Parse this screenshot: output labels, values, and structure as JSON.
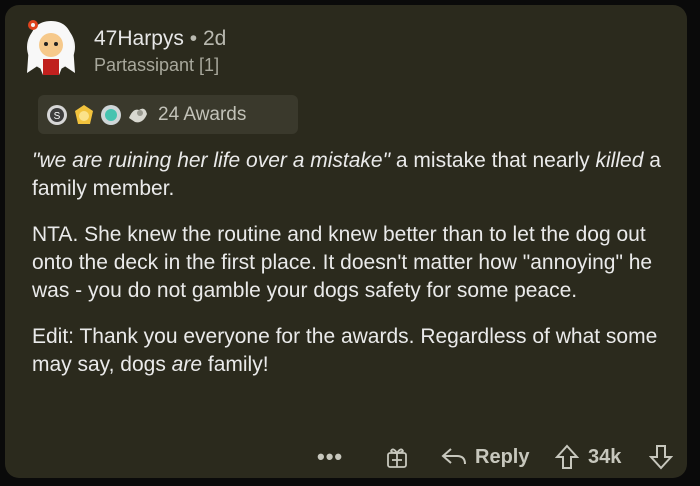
{
  "comment": {
    "username": "47Harpys",
    "separator": "•",
    "age": "2d",
    "flair": "Partassipant [1]",
    "awards_label": "24 Awards",
    "paragraphs": {
      "p1": {
        "quote": "\"we are ruining her life over a mistake\"",
        "mid": " a mistake that nearly ",
        "em": "killed",
        "end": " a family member."
      },
      "p2": "NTA. She knew the routine and knew better than to let the dog out onto the deck in the first place. It doesn't matter how \"annoying\" he was - you do not gamble your dogs safety for some peace.",
      "p3": {
        "start": "Edit: Thank you everyone for the awards. Regardless of what some may say, dogs ",
        "em": "are",
        "end": " family!"
      }
    }
  },
  "actions": {
    "more": "•••",
    "reply": "Reply",
    "score": "34k"
  },
  "icons": [
    "avatar",
    "silver-award-icon",
    "gold-award-icon",
    "helpful-award-icon",
    "wholesome-award-icon",
    "more-icon",
    "gift-icon",
    "reply-icon",
    "upvote-icon",
    "downvote-icon"
  ],
  "colors": {
    "card": "#2b2a1d",
    "text": "#eaeaea",
    "muted": "#a8a89c"
  }
}
